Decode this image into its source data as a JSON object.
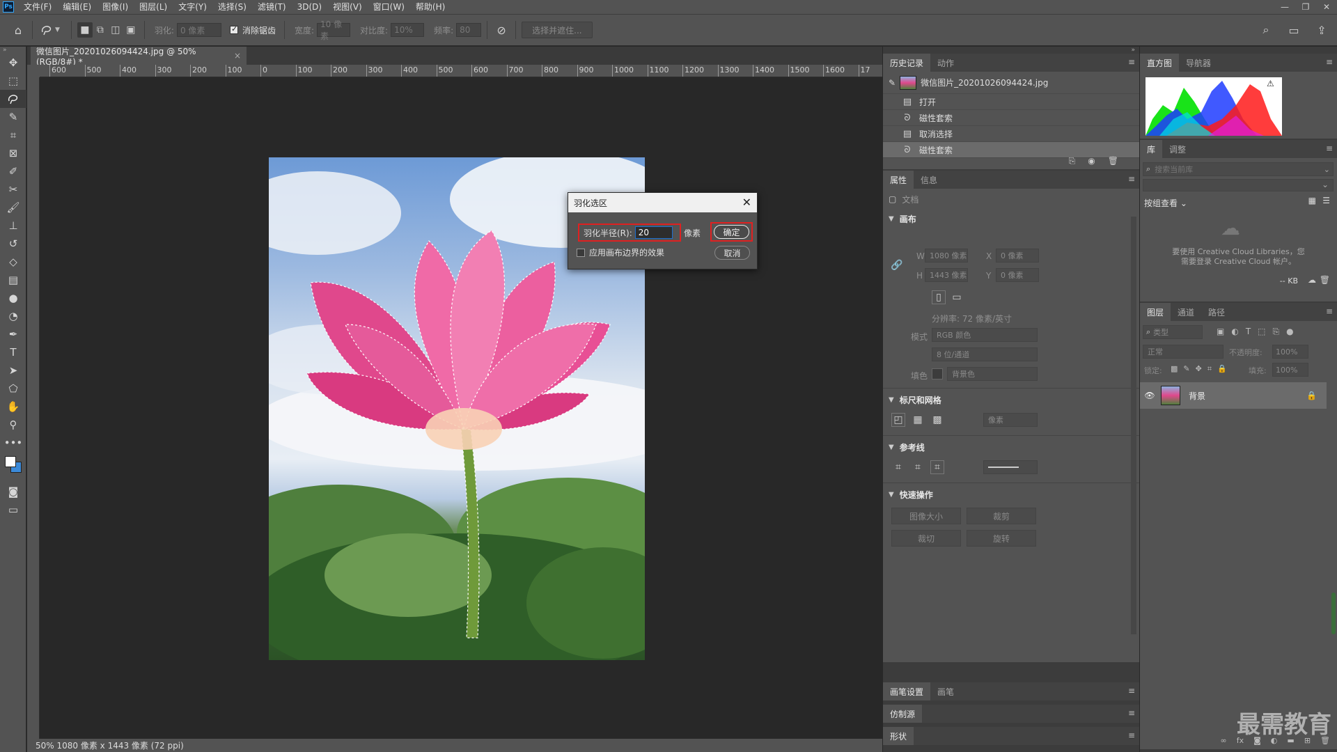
{
  "menubar": {
    "logo": "Ps",
    "items": [
      "文件(F)",
      "编辑(E)",
      "图像(I)",
      "图层(L)",
      "文字(Y)",
      "选择(S)",
      "滤镜(T)",
      "3D(D)",
      "视图(V)",
      "窗口(W)",
      "帮助(H)"
    ]
  },
  "options_bar": {
    "feather_label": "羽化:",
    "feather_value": "0 像素",
    "antialias_label": "消除锯齿",
    "width_label": "宽度:",
    "width_value": "10 像素",
    "contrast_label": "对比度:",
    "contrast_value": "10%",
    "frequency_label": "频率:",
    "frequency_value": "80",
    "select_mask_label": "选择并遮住..."
  },
  "document": {
    "tab_title": "微信图片_20201026094424.jpg @ 50%(RGB/8#) *",
    "tab_close": "×",
    "ruler_ticks": [
      "600",
      "500",
      "400",
      "300",
      "200",
      "100",
      "0",
      "100",
      "200",
      "300",
      "400",
      "500",
      "600",
      "700",
      "800",
      "900",
      "1000",
      "1100",
      "1200",
      "1300",
      "1400",
      "1500",
      "1600",
      "17"
    ],
    "status": "50%   1080 像素 x 1443 像素 (72 ppi)"
  },
  "dialog": {
    "title": "羽化选区",
    "radius_label": "羽化半径(R):",
    "radius_value": "20",
    "unit": "像素",
    "ok": "确定",
    "cancel": "取消",
    "apply_canvas_bounds": "应用画布边界的效果"
  },
  "history_panel": {
    "tabs": [
      "历史记录",
      "动作"
    ],
    "snapshot": "微信图片_20201026094424.jpg",
    "steps": [
      "打开",
      "磁性套索",
      "取消选择",
      "磁性套索"
    ]
  },
  "properties_panel": {
    "tabs": [
      "属性",
      "信息"
    ],
    "doc_label": "文档",
    "canvas_section": "画布",
    "w_label": "W",
    "w_value": "1080 像素",
    "x_label": "X",
    "x_value": "0 像素",
    "h_label": "H",
    "h_value": "1443 像素",
    "y_label": "Y",
    "y_value": "0 像素",
    "resolution": "分辨率: 72 像素/英寸",
    "mode_label": "模式",
    "mode_value": "RGB 颜色",
    "depth_value": "8 位/通道",
    "fill_label": "填色",
    "fill_value": "背景色",
    "rulers_section": "标尺和网格",
    "ruler_unit": "像素",
    "guides_section": "参考线",
    "quick_section": "快速操作",
    "quick_buttons": [
      "图像大小",
      "裁剪",
      "裁切",
      "旋转"
    ]
  },
  "bottom_panels": {
    "brush_tabs": [
      "画笔设置",
      "画笔"
    ],
    "clone_source": "仿制源",
    "shapes": "形状"
  },
  "histogram_panel": {
    "tabs": [
      "直方图",
      "导航器"
    ]
  },
  "library_panel": {
    "tabs": [
      "库",
      "调整"
    ],
    "search_placeholder": "搜索当前库",
    "view_by": "按组查看",
    "message_line1": "要使用 Creative Cloud Libraries，您",
    "message_line2": "需要登录 Creative Cloud 帐户。",
    "size": "-- KB"
  },
  "layers_panel": {
    "tabs": [
      "图层",
      "通道",
      "路径"
    ],
    "filter_label": "类型",
    "blend_mode": "正常",
    "opacity_label": "不透明度:",
    "opacity_value": "100%",
    "lock_label": "锁定:",
    "fill_label": "填充:",
    "fill_value": "100%",
    "layer_name": "背景"
  },
  "watermark": "最需教育",
  "colors": {
    "panel": "#535353",
    "dark": "#282828",
    "highlight_red": "#e02020",
    "accent_blue": "#1c6fd1"
  }
}
